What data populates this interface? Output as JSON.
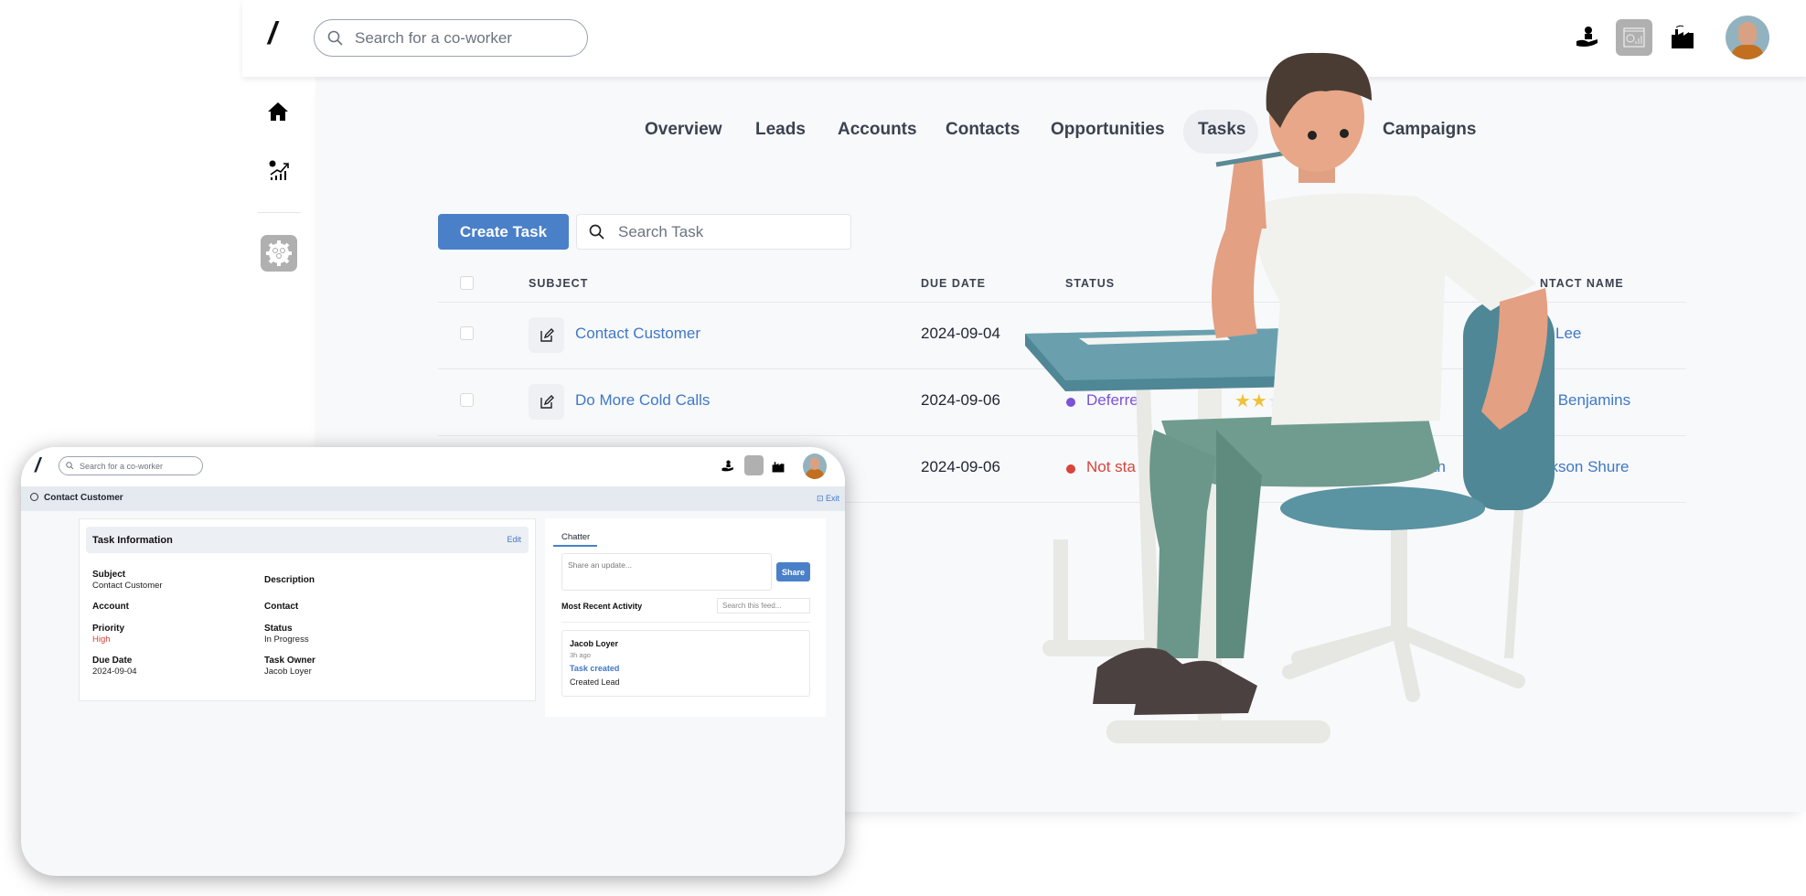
{
  "topbar": {
    "logo": "/",
    "search_placeholder": "Search for a co-worker",
    "icons": [
      "hand-person-icon",
      "finance-dashboard-icon",
      "factory-icon",
      "user-avatar"
    ]
  },
  "sidebar": {
    "icons": [
      "home-icon",
      "growth-chart-icon",
      "team-settings-icon"
    ]
  },
  "nav": {
    "tabs": [
      {
        "label": "Overview"
      },
      {
        "label": "Leads"
      },
      {
        "label": "Accounts"
      },
      {
        "label": "Contacts"
      },
      {
        "label": "Opportunities"
      },
      {
        "label": "Tasks",
        "active": true
      },
      {
        "label": "Campaigns"
      }
    ]
  },
  "toolbar": {
    "create_label": "Create Task",
    "search_placeholder": "Search Task"
  },
  "table": {
    "headers": {
      "subject": "SUBJECT",
      "due_date": "DUE DATE",
      "status": "STATUS",
      "contact": "NTACT NAME"
    },
    "rows": [
      {
        "subject": "Contact Customer",
        "due": "2024-09-04",
        "status": "",
        "status_color": "",
        "contact": "Lee"
      },
      {
        "subject": "Do More Cold Calls",
        "due": "2024-09-06",
        "status": "Deferre",
        "status_color": "#7b52d9",
        "stars": 2,
        "stars_max": 3,
        "contact": "ck Benjamins"
      },
      {
        "subject": "",
        "due": "2024-09-06",
        "status": "Not sta",
        "status_color": "#d9433a",
        "owner": "an",
        "contact": "Jackson Shure"
      }
    ]
  },
  "detail": {
    "search_placeholder": "Search for a co-worker",
    "title": "Contact Customer",
    "exit": "Exit",
    "card_title": "Task Information",
    "edit": "Edit",
    "fields": {
      "subject_label": "Subject",
      "subject": "Contact Customer",
      "description_label": "Description",
      "account_label": "Account",
      "contact_label": "Contact",
      "priority_label": "Priority",
      "priority": "High",
      "status_label": "Status",
      "status": "In Progress",
      "due_label": "Due Date",
      "due": "2024-09-04",
      "owner_label": "Task Owner",
      "owner": "Jacob Loyer"
    },
    "chatter": {
      "tab": "Chatter",
      "placeholder": "Share an update...",
      "share": "Share",
      "recent": "Most Recent Activity",
      "feed_placeholder": "Search this feed...",
      "activity": {
        "author": "Jacob Loyer",
        "time": "3h ago",
        "action": "Task created",
        "text": "Created Lead"
      }
    }
  },
  "colors": {
    "accent": "#4a80c8",
    "priority_high": "#d9433a"
  }
}
